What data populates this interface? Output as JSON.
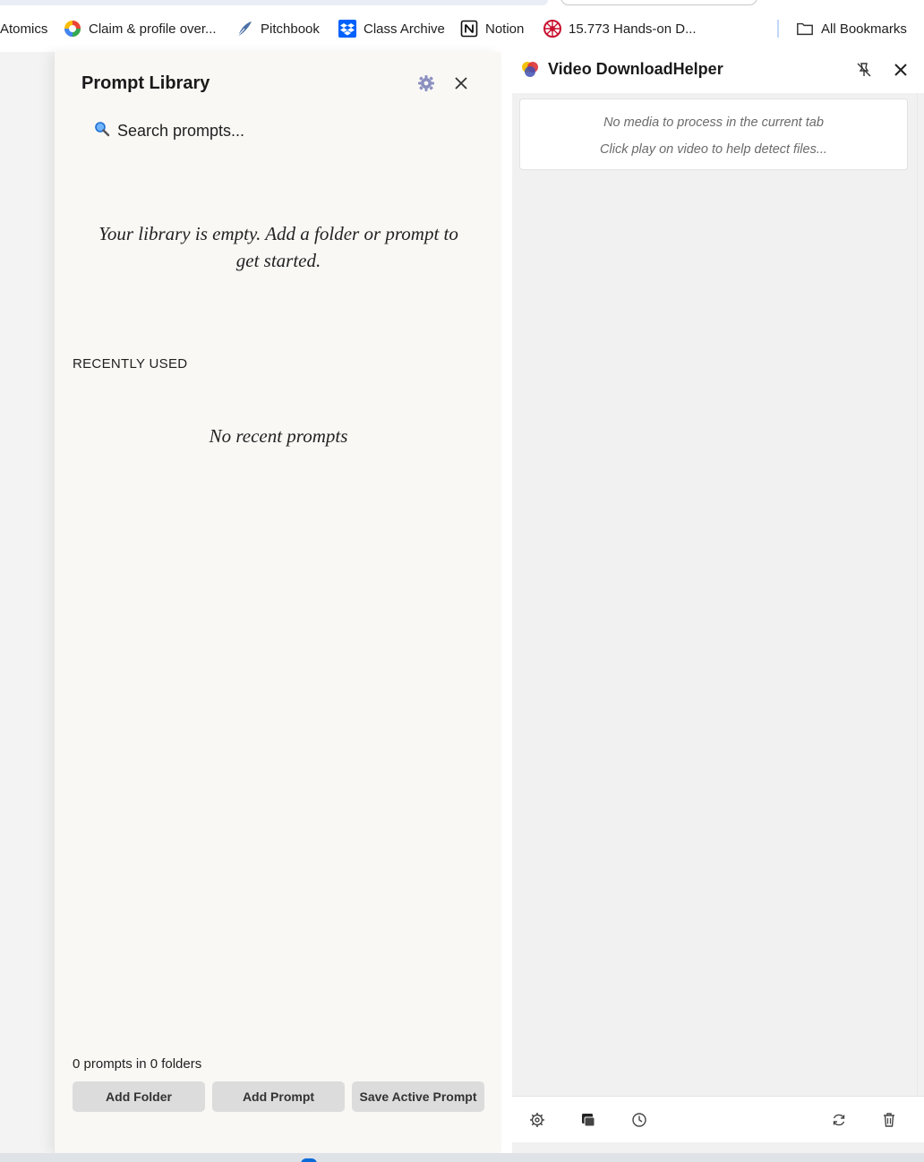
{
  "bookmarks": [
    {
      "label": "Atomics",
      "icon": "none"
    },
    {
      "label": "Claim & profile over...",
      "icon": "google-multicolor-icon"
    },
    {
      "label": "Pitchbook",
      "icon": "pitchbook-feather-icon"
    },
    {
      "label": "Class Archive",
      "icon": "dropbox-icon"
    },
    {
      "label": "Notion",
      "icon": "notion-icon"
    },
    {
      "label": "15.773 Hands-on D...",
      "icon": "mit-red-icon"
    }
  ],
  "all_bookmarks": {
    "label": "All Bookmarks",
    "icon": "folder-icon"
  },
  "prompt_library": {
    "title": "Prompt Library",
    "search_placeholder": "Search prompts...",
    "empty_message": "Your library is empty. Add a folder or prompt to get started.",
    "recent_heading": "RECENTLY USED",
    "recent_empty": "No recent prompts",
    "count_text": "0 prompts in 0 folders",
    "buttons": {
      "add_folder": "Add Folder",
      "add_prompt": "Add Prompt",
      "save_active": "Save Active Prompt"
    }
  },
  "vdh": {
    "title": "Video DownloadHelper",
    "line1": "No media to process in the current tab",
    "line2": "Click play on video to help detect files..."
  },
  "colors": {
    "panel_bg": "#f9f8f5",
    "button_bg": "#dcdcdc",
    "vdh_bg": "#f1f1f1"
  }
}
